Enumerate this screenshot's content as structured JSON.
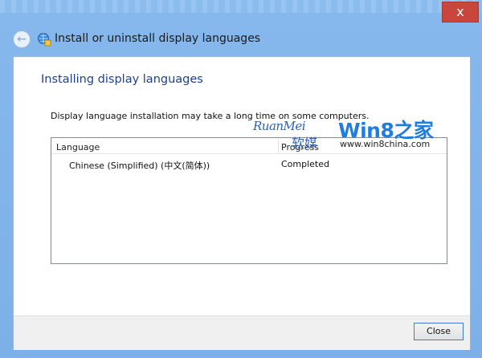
{
  "window": {
    "title": "Install or uninstall display languages",
    "close_glyph": "x",
    "back_glyph": "←"
  },
  "main": {
    "heading": "Installing display languages",
    "description": "Display language installation may take a long time on some computers.",
    "list": {
      "columns": [
        "Language",
        "Progress"
      ],
      "rows": [
        {
          "language": "Chinese (Simplified) (中文(简体))",
          "progress": "Completed"
        }
      ]
    }
  },
  "watermark": {
    "brand_left": "RuanMei",
    "brand_left_cn": "软媒",
    "brand_right": "Win8之家",
    "url": "www.win8china.com"
  },
  "footer": {
    "close_label": "Close"
  },
  "colors": {
    "accent": "#1f3f8c",
    "frame": "#7fb5ec",
    "watermark_blue": "#1f7de0"
  }
}
